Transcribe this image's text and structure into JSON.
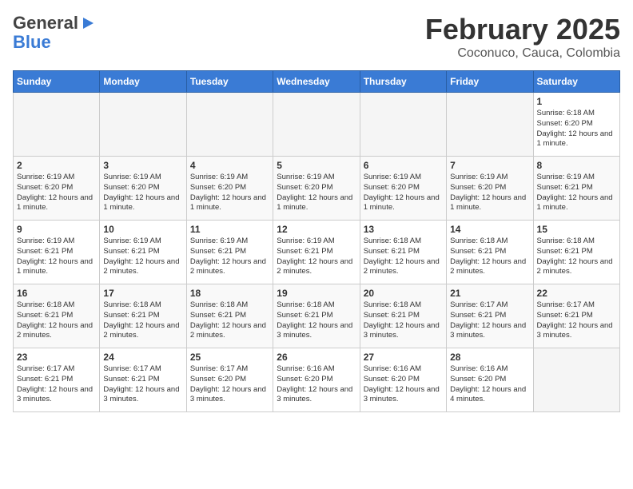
{
  "header": {
    "logo_general": "General",
    "logo_blue": "Blue",
    "month": "February 2025",
    "location": "Coconuco, Cauca, Colombia"
  },
  "weekdays": [
    "Sunday",
    "Monday",
    "Tuesday",
    "Wednesday",
    "Thursday",
    "Friday",
    "Saturday"
  ],
  "weeks": [
    [
      {
        "day": "",
        "info": ""
      },
      {
        "day": "",
        "info": ""
      },
      {
        "day": "",
        "info": ""
      },
      {
        "day": "",
        "info": ""
      },
      {
        "day": "",
        "info": ""
      },
      {
        "day": "",
        "info": ""
      },
      {
        "day": "1",
        "info": "Sunrise: 6:18 AM\nSunset: 6:20 PM\nDaylight: 12 hours\nand 1 minute."
      }
    ],
    [
      {
        "day": "2",
        "info": "Sunrise: 6:19 AM\nSunset: 6:20 PM\nDaylight: 12 hours\nand 1 minute."
      },
      {
        "day": "3",
        "info": "Sunrise: 6:19 AM\nSunset: 6:20 PM\nDaylight: 12 hours\nand 1 minute."
      },
      {
        "day": "4",
        "info": "Sunrise: 6:19 AM\nSunset: 6:20 PM\nDaylight: 12 hours\nand 1 minute."
      },
      {
        "day": "5",
        "info": "Sunrise: 6:19 AM\nSunset: 6:20 PM\nDaylight: 12 hours\nand 1 minute."
      },
      {
        "day": "6",
        "info": "Sunrise: 6:19 AM\nSunset: 6:20 PM\nDaylight: 12 hours\nand 1 minute."
      },
      {
        "day": "7",
        "info": "Sunrise: 6:19 AM\nSunset: 6:20 PM\nDaylight: 12 hours\nand 1 minute."
      },
      {
        "day": "8",
        "info": "Sunrise: 6:19 AM\nSunset: 6:21 PM\nDaylight: 12 hours\nand 1 minute."
      }
    ],
    [
      {
        "day": "9",
        "info": "Sunrise: 6:19 AM\nSunset: 6:21 PM\nDaylight: 12 hours\nand 1 minute."
      },
      {
        "day": "10",
        "info": "Sunrise: 6:19 AM\nSunset: 6:21 PM\nDaylight: 12 hours\nand 2 minutes."
      },
      {
        "day": "11",
        "info": "Sunrise: 6:19 AM\nSunset: 6:21 PM\nDaylight: 12 hours\nand 2 minutes."
      },
      {
        "day": "12",
        "info": "Sunrise: 6:19 AM\nSunset: 6:21 PM\nDaylight: 12 hours\nand 2 minutes."
      },
      {
        "day": "13",
        "info": "Sunrise: 6:18 AM\nSunset: 6:21 PM\nDaylight: 12 hours\nand 2 minutes."
      },
      {
        "day": "14",
        "info": "Sunrise: 6:18 AM\nSunset: 6:21 PM\nDaylight: 12 hours\nand 2 minutes."
      },
      {
        "day": "15",
        "info": "Sunrise: 6:18 AM\nSunset: 6:21 PM\nDaylight: 12 hours\nand 2 minutes."
      }
    ],
    [
      {
        "day": "16",
        "info": "Sunrise: 6:18 AM\nSunset: 6:21 PM\nDaylight: 12 hours\nand 2 minutes."
      },
      {
        "day": "17",
        "info": "Sunrise: 6:18 AM\nSunset: 6:21 PM\nDaylight: 12 hours\nand 2 minutes."
      },
      {
        "day": "18",
        "info": "Sunrise: 6:18 AM\nSunset: 6:21 PM\nDaylight: 12 hours\nand 2 minutes."
      },
      {
        "day": "19",
        "info": "Sunrise: 6:18 AM\nSunset: 6:21 PM\nDaylight: 12 hours\nand 3 minutes."
      },
      {
        "day": "20",
        "info": "Sunrise: 6:18 AM\nSunset: 6:21 PM\nDaylight: 12 hours\nand 3 minutes."
      },
      {
        "day": "21",
        "info": "Sunrise: 6:17 AM\nSunset: 6:21 PM\nDaylight: 12 hours\nand 3 minutes."
      },
      {
        "day": "22",
        "info": "Sunrise: 6:17 AM\nSunset: 6:21 PM\nDaylight: 12 hours\nand 3 minutes."
      }
    ],
    [
      {
        "day": "23",
        "info": "Sunrise: 6:17 AM\nSunset: 6:21 PM\nDaylight: 12 hours\nand 3 minutes."
      },
      {
        "day": "24",
        "info": "Sunrise: 6:17 AM\nSunset: 6:21 PM\nDaylight: 12 hours\nand 3 minutes."
      },
      {
        "day": "25",
        "info": "Sunrise: 6:17 AM\nSunset: 6:20 PM\nDaylight: 12 hours\nand 3 minutes."
      },
      {
        "day": "26",
        "info": "Sunrise: 6:16 AM\nSunset: 6:20 PM\nDaylight: 12 hours\nand 3 minutes."
      },
      {
        "day": "27",
        "info": "Sunrise: 6:16 AM\nSunset: 6:20 PM\nDaylight: 12 hours\nand 3 minutes."
      },
      {
        "day": "28",
        "info": "Sunrise: 6:16 AM\nSunset: 6:20 PM\nDaylight: 12 hours\nand 4 minutes."
      },
      {
        "day": "",
        "info": ""
      }
    ]
  ]
}
